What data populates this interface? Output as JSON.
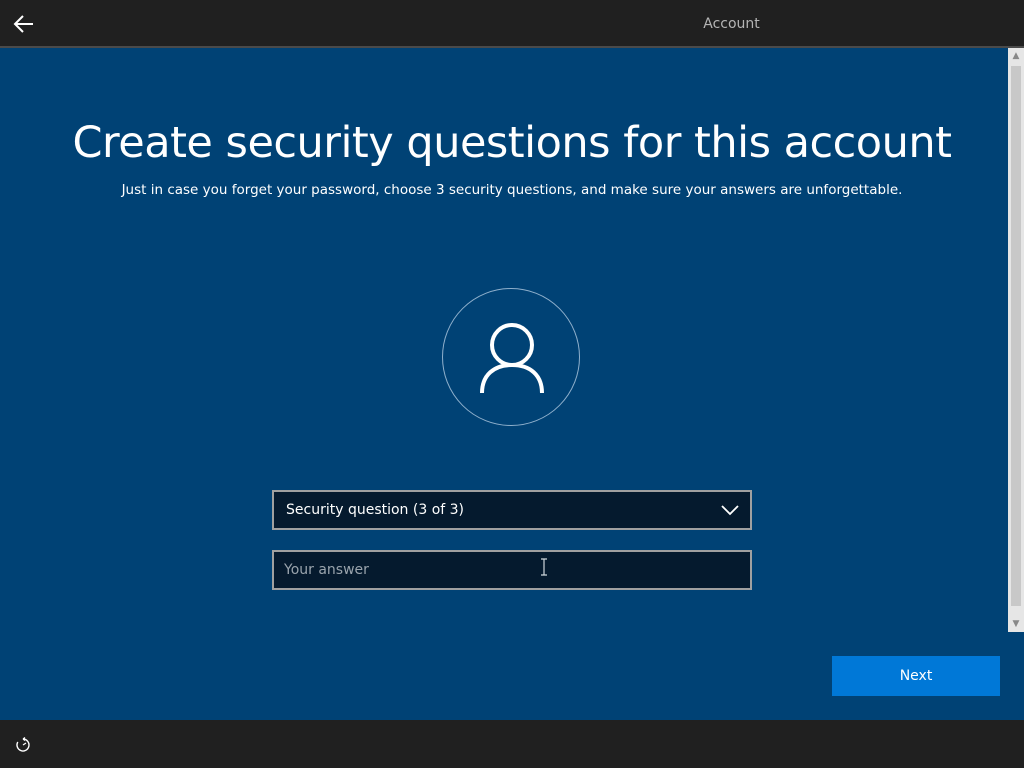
{
  "header": {
    "back_icon": "back-arrow-icon",
    "active_tab": "Account"
  },
  "main": {
    "title": "Create security questions for this account",
    "subtitle": "Just in case you forget your password, choose 3 security questions, and make sure your answers are unforgettable.",
    "avatar_icon": "user-icon",
    "security_question": {
      "selected": "Security question (3 of 3)",
      "icon": "chevron-down-icon"
    },
    "answer": {
      "value": "",
      "placeholder": "Your answer"
    },
    "next_label": "Next"
  },
  "footer": {
    "icon": "ease-of-access-icon"
  },
  "colors": {
    "background": "#004275",
    "bars": "#202020",
    "accent": "#0078d7",
    "input_background": "#051a2e"
  }
}
